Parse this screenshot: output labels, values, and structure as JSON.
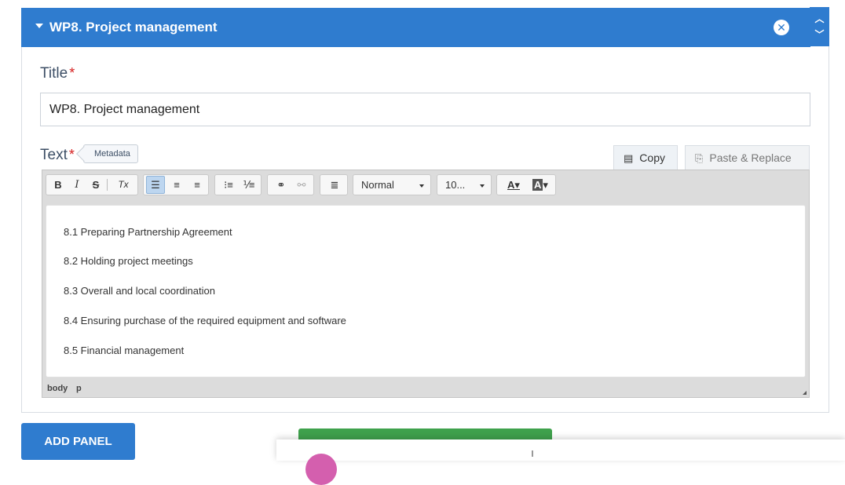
{
  "panel": {
    "title": "WP8. Project management",
    "close_icon": "close-circle-icon",
    "move_up_icon": "chevron-up-icon",
    "move_down_icon": "chevron-down-icon"
  },
  "title_field": {
    "label": "Title",
    "required_mark": "*",
    "value": "WP8. Project management"
  },
  "text_field": {
    "label": "Text",
    "required_mark": "*",
    "metadata_tag": "Metadata",
    "copy_label": "Copy",
    "paste_label": "Paste & Replace"
  },
  "toolbar": {
    "bold": "B",
    "italic": "I",
    "strike": "S",
    "clear_format": "Tx",
    "format_value": "Normal",
    "size_value": "10...",
    "text_color": "A",
    "bg_color": "A"
  },
  "editor": {
    "paragraphs": [
      "8.1 Preparing Partnership Agreement",
      "8.2 Holding project meetings",
      "8.3 Overall and local coordination",
      "8.4 Ensuring purchase of the required equipment and software",
      "8.5 Financial management"
    ],
    "path": [
      "body",
      "p"
    ]
  },
  "actions": {
    "add_panel_label": "ADD PANEL"
  },
  "colors": {
    "primary": "#2f7ccf",
    "success": "#3fa14c",
    "required": "#d62020",
    "avatar": "#d45fae"
  }
}
